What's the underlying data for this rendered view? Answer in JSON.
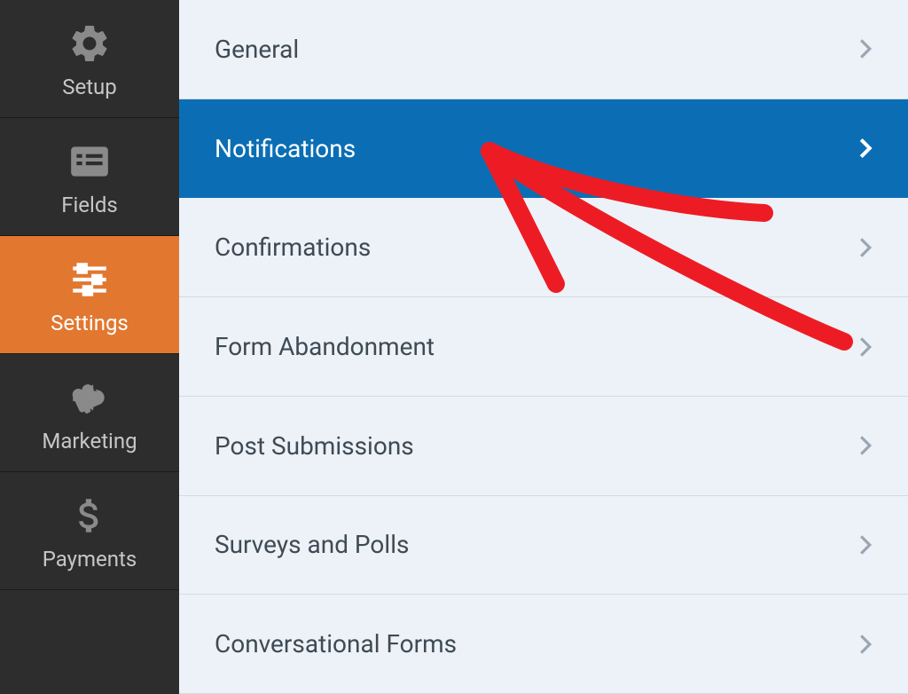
{
  "sidebar": {
    "items": [
      {
        "label": "Setup",
        "icon": "gear-icon",
        "active": false
      },
      {
        "label": "Fields",
        "icon": "list-icon",
        "active": false
      },
      {
        "label": "Settings",
        "icon": "sliders-icon",
        "active": true
      },
      {
        "label": "Marketing",
        "icon": "megaphone-icon",
        "active": false
      },
      {
        "label": "Payments",
        "icon": "dollar-icon",
        "active": false
      }
    ]
  },
  "settings": {
    "items": [
      {
        "label": "General",
        "selected": false
      },
      {
        "label": "Notifications",
        "selected": true
      },
      {
        "label": "Confirmations",
        "selected": false
      },
      {
        "label": "Form Abandonment",
        "selected": false
      },
      {
        "label": "Post Submissions",
        "selected": false
      },
      {
        "label": "Surveys and Polls",
        "selected": false
      },
      {
        "label": "Conversational Forms",
        "selected": false
      }
    ]
  }
}
